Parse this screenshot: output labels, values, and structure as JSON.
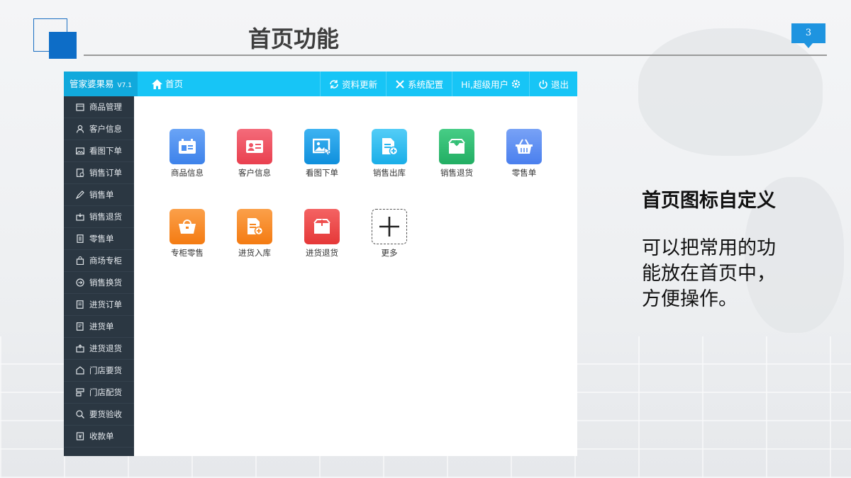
{
  "slide": {
    "title": "首页功能",
    "page_number": "3",
    "heading": "首页图标自定义",
    "description_lines": [
      "可以把常用的功",
      "能放在首页中，",
      "方便操作。"
    ]
  },
  "app": {
    "brand": "管家婆果易",
    "version": "V7.1",
    "home_label": "首页",
    "top_actions": {
      "refresh": "资料更新",
      "settings": "系统配置",
      "user": "Hi,超级用户",
      "logout": "退出"
    },
    "sidebar": [
      {
        "label": "商品管理",
        "icon": "box-icon"
      },
      {
        "label": "客户信息",
        "icon": "user-icon"
      },
      {
        "label": "看图下单",
        "icon": "image-icon"
      },
      {
        "label": "销售订单",
        "icon": "order-icon"
      },
      {
        "label": "销售单",
        "icon": "pen-icon"
      },
      {
        "label": "销售退货",
        "icon": "return-box-icon"
      },
      {
        "label": "零售单",
        "icon": "document-icon"
      },
      {
        "label": "商场专柜",
        "icon": "bag-icon"
      },
      {
        "label": "销售换货",
        "icon": "exchange-icon"
      },
      {
        "label": "进货订单",
        "icon": "purchase-order-icon"
      },
      {
        "label": "进货单",
        "icon": "purchase-icon"
      },
      {
        "label": "进货退货",
        "icon": "purchase-return-icon"
      },
      {
        "label": "门店要货",
        "icon": "store-icon"
      },
      {
        "label": "门店配货",
        "icon": "dispatch-icon"
      },
      {
        "label": "要货验收",
        "icon": "search-check-icon"
      },
      {
        "label": "收款单",
        "icon": "receipt-icon"
      }
    ],
    "tiles": [
      {
        "label": "商品信息",
        "icon": "product-card-icon",
        "color": "#4b8ff0"
      },
      {
        "label": "客户信息",
        "icon": "id-card-icon",
        "color": "#ef5466"
      },
      {
        "label": "看图下单",
        "icon": "picture-icon",
        "color": "#1ea0e8"
      },
      {
        "label": "销售出库",
        "icon": "doc-add-icon",
        "color": "#27b6f0"
      },
      {
        "label": "销售退货",
        "icon": "tray-in-icon",
        "color": "#2ebd72"
      },
      {
        "label": "零售单",
        "icon": "basket-icon",
        "color": "#5b8ff2"
      },
      {
        "label": "专柜零售",
        "icon": "handbag-icon",
        "color": "#f7861e"
      },
      {
        "label": "进货入库",
        "icon": "doc-add-icon",
        "color": "#f7861e"
      },
      {
        "label": "进货退货",
        "icon": "tray-out-icon",
        "color": "#ef4c4c"
      },
      {
        "label": "更多",
        "icon": "plus-icon",
        "color": "#ffffff"
      }
    ]
  }
}
